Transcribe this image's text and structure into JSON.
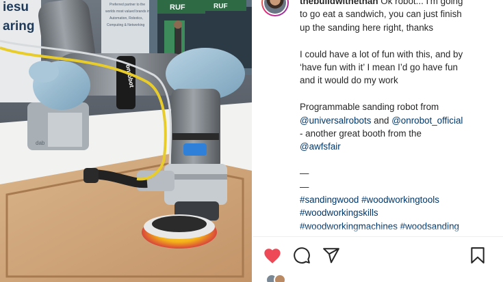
{
  "photo": {
    "booth_banner_fragment": [
      "iesu",
      "aring"
    ],
    "booth_sign_lines": [
      "Preferred partner to the",
      "worlds most valued brands in",
      "Automation, Robotics,",
      "Computing & Networking"
    ],
    "robot_band_text": "onrobot",
    "exhibit_sign_1": "RUF",
    "exhibit_sign_2": "RUF",
    "base_label": "dab"
  },
  "post": {
    "username": "thebuildwithethan",
    "caption_first_line_rest": "Ok robot... I'm going",
    "caption_line2": "to go eat a sandwich, you can just finish",
    "caption_line3": "up the sanding here right, thanks",
    "paragraph2_line1": "I could have a lot of fun with this, and by",
    "paragraph2_line2": "‘have fun with it’ I mean I’d go have fun",
    "paragraph2_line3": "and it would do my work",
    "paragraph3_line1": "Programmable sanding robot from",
    "mention_universal": "@universalrobots",
    "and_text": "and",
    "mention_onrobot": "@onrobot_official",
    "paragraph3_line3": "- another great booth from the",
    "mention_awfs": "@awfsfair",
    "dash1": "—",
    "dash2": "—",
    "hashtags": [
      "#sandingwood #woodworkingtools",
      "#woodworkingskills",
      "#woodworkingmachines #woodsanding"
    ]
  },
  "actions": {
    "like_label": "Like",
    "comment_label": "Comment",
    "share_label": "Share",
    "save_label": "Save"
  },
  "colors": {
    "like_red": "#ed4956",
    "link_blue": "#00376b",
    "text": "#262626"
  },
  "icons": [
    "heart-icon",
    "comment-icon",
    "share-icon",
    "bookmark-icon"
  ]
}
